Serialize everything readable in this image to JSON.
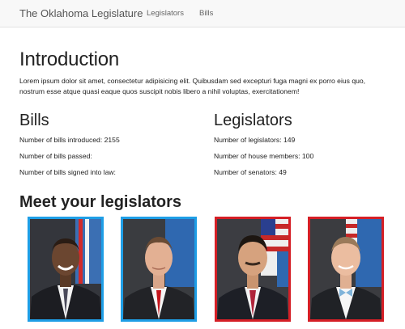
{
  "navbar": {
    "brand": "The Oklahoma Legislature",
    "links": [
      "Legislators",
      "Bills"
    ]
  },
  "intro": {
    "title": "Introduction",
    "body": "Lorem ipsum dolor sit amet, consectetur adipisicing elit. Quibusdam sed excepturi fuga magni ex porro eius quo, nostrum esse atque quasi eaque quos suscipit nobis libero a nihil voluptas, exercitationem!"
  },
  "bills": {
    "heading": "Bills",
    "introduced": "Number of bills introduced: 2155",
    "passed": "Number of bills passed:",
    "signed": "Number of bills signed into law:"
  },
  "legislators": {
    "heading": "Legislators",
    "total": "Number of legislators: 149",
    "house": "Number of house members: 100",
    "senate": "Number of senators: 49"
  },
  "meet": {
    "heading": "Meet your legislators",
    "photos": [
      {
        "party_color": "#1e9ee6"
      },
      {
        "party_color": "#1e9ee6"
      },
      {
        "party_color": "#d51f26"
      },
      {
        "party_color": "#d51f26"
      }
    ]
  }
}
